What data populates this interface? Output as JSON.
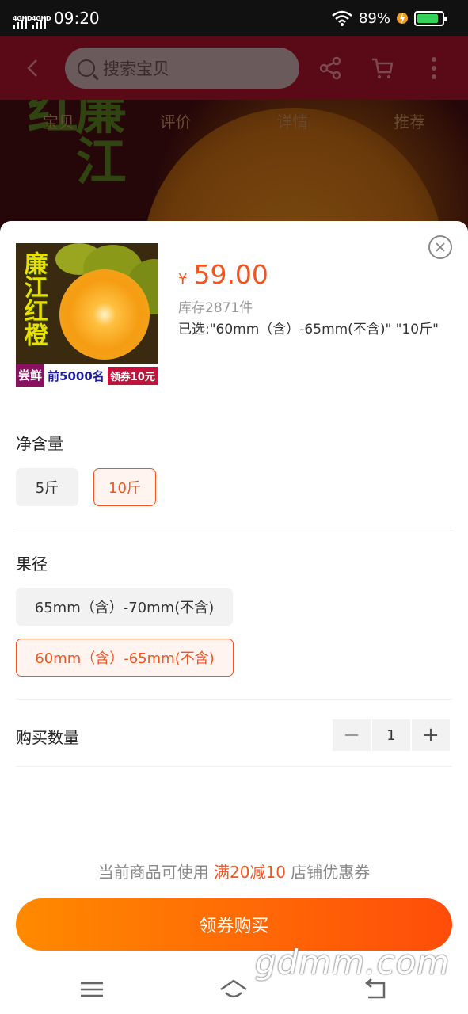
{
  "status_bar": {
    "signal1_label": "4GHD",
    "signal2_label": "4GHD",
    "time": "09:20",
    "battery_percent": "89%",
    "battery_level": 0.89
  },
  "header": {
    "search_placeholder": "搜索宝贝"
  },
  "background": {
    "tabs": [
      "宝贝",
      "评价",
      "详情",
      "推荐"
    ],
    "calligraphy": "廉江红"
  },
  "product": {
    "thumb_calligraphy": "廉江红橙",
    "thumb_strip": [
      "尝鲜",
      "前5000名",
      "领券10元"
    ],
    "currency": "¥",
    "price": "59.00",
    "stock": "库存2871件",
    "selected": "已选:\"60mm（含）-65mm(不含)\" \"10斤\""
  },
  "net_weight": {
    "title": "净含量",
    "options": [
      "5斤",
      "10斤"
    ],
    "selected_index": 1
  },
  "diameter": {
    "title": "果径",
    "options": [
      "65mm（含）-70mm(不含)",
      "60mm（含）-65mm(不含)"
    ],
    "selected_index": 1
  },
  "quantity": {
    "label": "购买数量",
    "minus": "−",
    "value": "1",
    "plus": "+"
  },
  "coupon": {
    "prefix": "当前商品可使用 ",
    "highlight": "满20减10",
    "suffix": " 店铺优惠券"
  },
  "cta": {
    "label": "领券购买"
  },
  "watermark": "gdmm.com",
  "colors": {
    "accent": "#f2541f",
    "cta_start": "#ff8a00",
    "cta_end": "#ff4d0a"
  }
}
